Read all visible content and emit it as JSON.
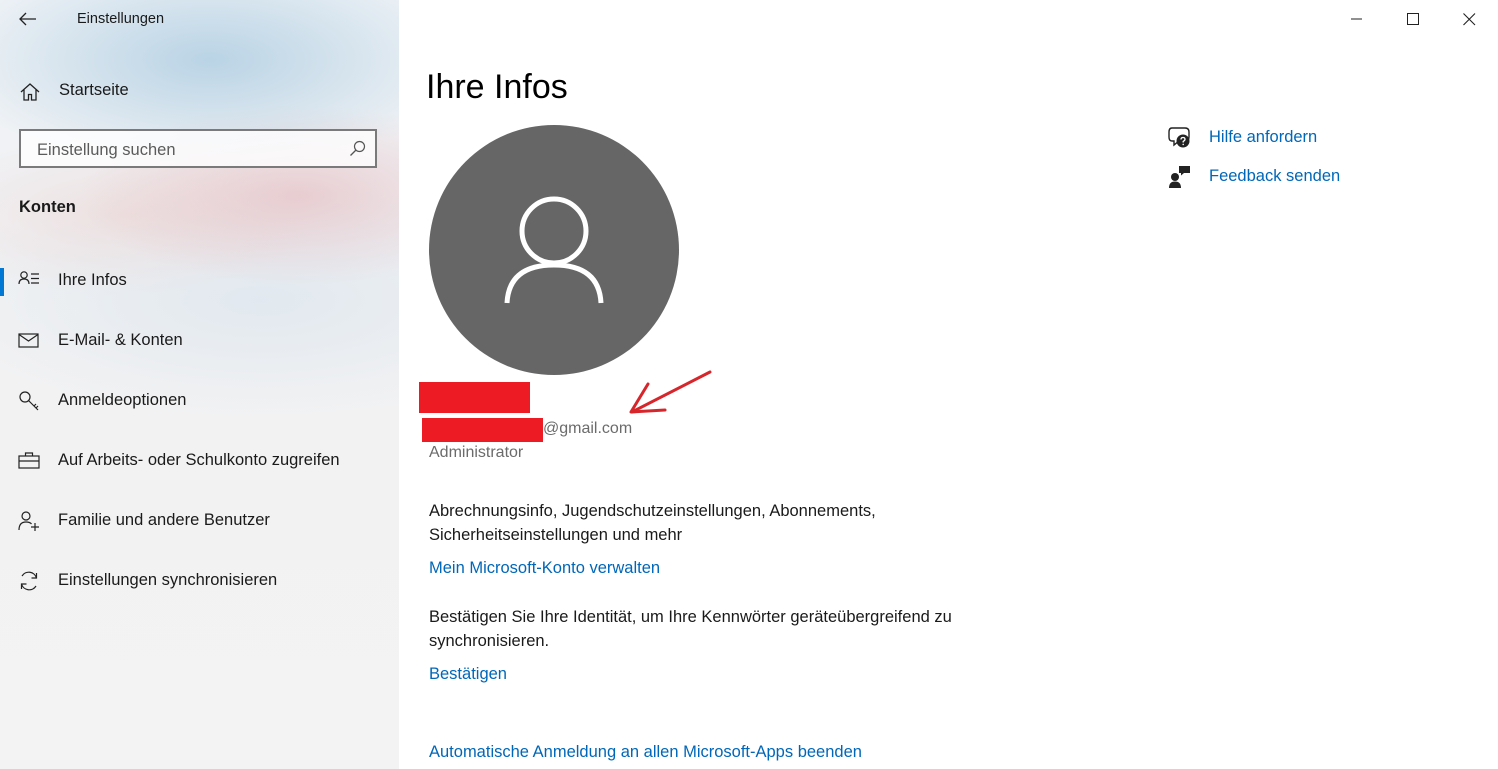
{
  "window": {
    "title": "Einstellungen",
    "controls": {
      "minimize": "minimize",
      "maximize": "maximize",
      "close": "close"
    }
  },
  "sidebar": {
    "home_label": "Startseite",
    "search": {
      "placeholder": "Einstellung suchen",
      "value": ""
    },
    "section_label": "Konten",
    "items": [
      {
        "label": "Ihre Infos",
        "icon": "person-list-icon",
        "selected": true
      },
      {
        "label": "E-Mail- & Konten",
        "icon": "mail-icon",
        "selected": false
      },
      {
        "label": "Anmeldeoptionen",
        "icon": "key-icon",
        "selected": false
      },
      {
        "label": "Auf Arbeits- oder Schulkonto zugreifen",
        "icon": "briefcase-icon",
        "selected": false
      },
      {
        "label": "Familie und andere Benutzer",
        "icon": "add-person-icon",
        "selected": false
      },
      {
        "label": "Einstellungen synchronisieren",
        "icon": "sync-icon",
        "selected": false
      }
    ]
  },
  "main": {
    "title": "Ihre Infos",
    "profile": {
      "email_suffix": "@gmail.com",
      "role": "Administrator"
    },
    "billing_text": "Abrechnungsinfo, Jugendschutzeinstellungen, Abonnements, Sicherheitseinstellungen und mehr",
    "manage_account_link": "Mein Microsoft-Konto verwalten",
    "verify_text": "Bestätigen Sie Ihre Identität, um Ihre Kennwörter geräteübergreifend zu synchronisieren.",
    "verify_link": "Bestätigen",
    "auto_signin_link": "Automatische Anmeldung an allen Microsoft-Apps beenden"
  },
  "help": {
    "get_help": "Hilfe anfordern",
    "feedback": "Feedback senden"
  },
  "colors": {
    "accent": "#0078d4",
    "link": "#0067b8",
    "avatar_bg": "#666666",
    "redaction": "#ed1c24"
  }
}
